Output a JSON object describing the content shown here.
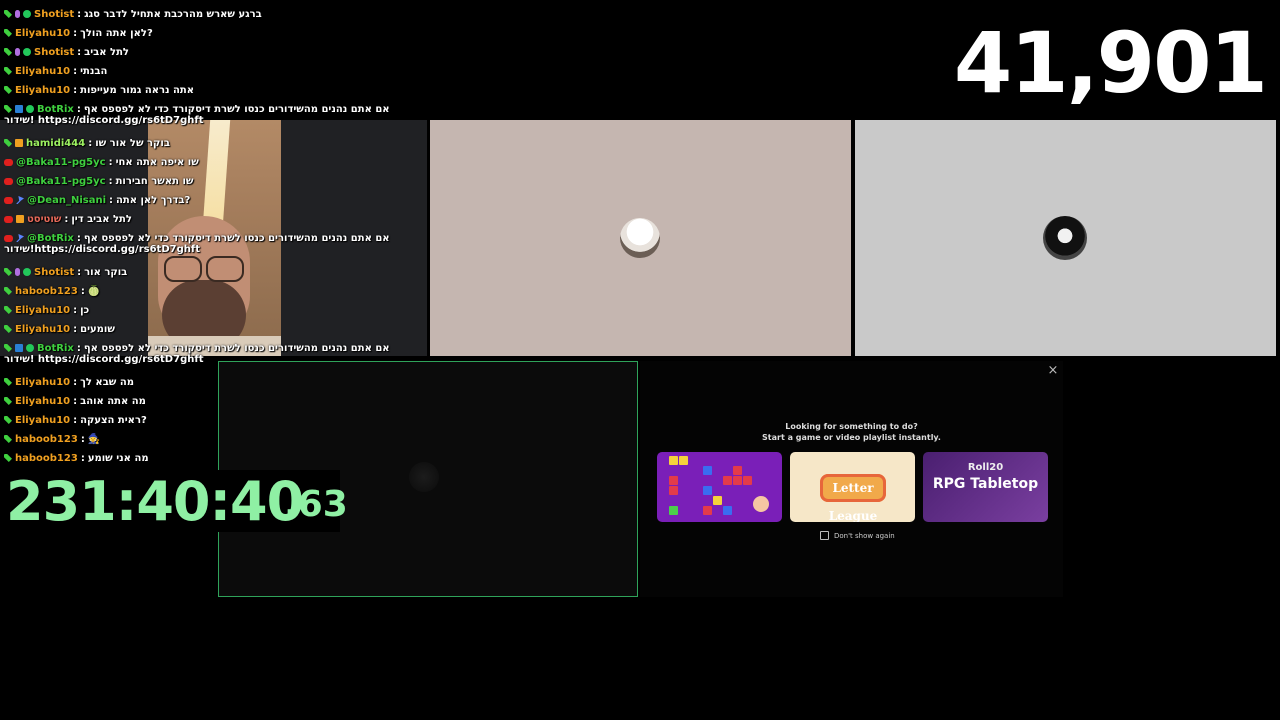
{
  "counter": "41,901",
  "timer": {
    "main": "231:40:40",
    "ms": ".63"
  },
  "panel": {
    "heading1": "Looking for something to do?",
    "heading2": "Start a game or video playlist instantly.",
    "cards": [
      {
        "name": "tetris-card"
      },
      {
        "name": "letter-league-card",
        "logo": "Letter League"
      },
      {
        "name": "rpg-card",
        "sub": "Roll20",
        "title": "RPG Tabletop"
      }
    ],
    "dont_show": "Don't show again",
    "close": "×"
  },
  "chat": [
    {
      "user": "Shotist",
      "color": "#f0a020",
      "text": "ברגע שארש מהרכבת אתחיל לדבר סגג",
      "badges": [
        "sword",
        "mic",
        "check"
      ]
    },
    {
      "user": "Eliyahu10",
      "color": "#f0a020",
      "text": "לאן אתה הולך?",
      "badges": [
        "sword"
      ]
    },
    {
      "user": "Shotist",
      "color": "#f0a020",
      "text": "לתל אביב",
      "badges": [
        "sword",
        "mic",
        "check"
      ]
    },
    {
      "user": "Eliyahu10",
      "color": "#f0a020",
      "text": "הבנתי",
      "badges": [
        "sword"
      ]
    },
    {
      "user": "Eliyahu10",
      "color": "#f0a020",
      "text": "אתה נראה גמור מעייפות",
      "badges": [
        "sword"
      ]
    },
    {
      "user": "BotRix",
      "color": "#3fd03f",
      "text": "אם אתם נהנים מהשידורים כנסו לשרת דיסקורד כדי לא לפספס אף",
      "badges": [
        "sword",
        "bot",
        "check"
      ],
      "cont": "שידור! https://discord.gg/rs6tD7ghft"
    },
    {
      "user": "hamidi444",
      "color": "#9cf060",
      "text": "בוקר של אור שו",
      "badges": [
        "sword",
        "crown"
      ]
    },
    {
      "user": "@Baka11-pg5yc",
      "color": "#3fd03f",
      "text": "שו איפה אתה אחי",
      "badges": [
        "yt"
      ]
    },
    {
      "user": "@Baka11-pg5yc",
      "color": "#3fd03f",
      "text": "שו תאשר חבירות",
      "badges": [
        "yt"
      ]
    },
    {
      "user": "@Dean_Nisani",
      "color": "#3fd03f",
      "text": "בדרך לאן אתה?",
      "badges": [
        "yt",
        "tool"
      ]
    },
    {
      "user": "שוטיסט",
      "color": "#e86a5a",
      "text": "לתל אביב דין",
      "badges": [
        "yt",
        "crown"
      ],
      "rtl": true
    },
    {
      "user": "@BotRix",
      "color": "#3fd03f",
      "text": "אם אתם נהנים מהשידורים כנסו לשרת דיסקורד כדי לא לפספס אף",
      "badges": [
        "yt",
        "tool"
      ],
      "cont": "שידור!https://discord.gg/rs6tD7ghft"
    },
    {
      "user": "Shotist",
      "color": "#f0a020",
      "text": "בוקר אור",
      "badges": [
        "sword",
        "mic",
        "check"
      ]
    },
    {
      "user": "haboob123",
      "color": "#f0a020",
      "text": "🍈",
      "badges": [
        "sword"
      ]
    },
    {
      "user": "Eliyahu10",
      "color": "#f0a020",
      "text": "כן",
      "badges": [
        "sword"
      ]
    },
    {
      "user": "Eliyahu10",
      "color": "#f0a020",
      "text": "שומעים",
      "badges": [
        "sword"
      ]
    },
    {
      "user": "BotRix",
      "color": "#3fd03f",
      "text": "אם אתם נהנים מהשידורים כנסו לשרת דיסקורד כדי לא לפספס אף",
      "badges": [
        "sword",
        "bot",
        "check"
      ],
      "cont": "שידור! https://discord.gg/rs6tD7ghft"
    },
    {
      "user": "Eliyahu10",
      "color": "#f0a020",
      "text": "מה שבא לך",
      "badges": [
        "sword"
      ]
    },
    {
      "user": "Eliyahu10",
      "color": "#f0a020",
      "text": "מה אתה אוהב",
      "badges": [
        "sword"
      ]
    },
    {
      "user": "Eliyahu10",
      "color": "#f0a020",
      "text": "ראית הצעקה?",
      "badges": [
        "sword"
      ]
    },
    {
      "user": "haboob123",
      "color": "#f0a020",
      "text": "🧙",
      "badges": [
        "sword"
      ]
    },
    {
      "user": "haboob123",
      "color": "#f0a020",
      "text": "מה אני שומע",
      "badges": [
        "sword"
      ]
    }
  ]
}
